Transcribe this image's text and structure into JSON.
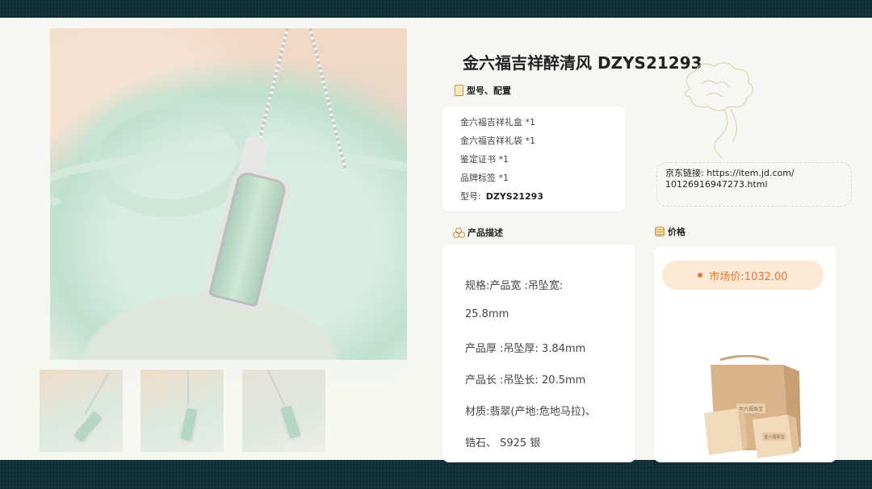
{
  "product": {
    "title": "金六福吉祥醉清风 DZYS21293"
  },
  "config_section": {
    "label": "型号、配置",
    "icon": "document-icon",
    "items": [
      "金六福吉祥礼盒 *1",
      "金六福吉祥礼袋 *1",
      "鉴定证书 *1",
      "品牌标签 *1"
    ],
    "model_label": "型号:",
    "model_value": "DZYS21293"
  },
  "link": {
    "label": "京东链接:",
    "url_part1": "https://item.jd.com/",
    "url_part2": "10126916947273.html"
  },
  "description_section": {
    "label": "产品描述",
    "icon": "cluster-icon",
    "lines": [
      "规格:产品宽 :吊坠宽:",
      "25.8mm",
      "产品厚 :吊坠厚: 3.84mm",
      "产品长 :吊坠长: 20.5mm",
      "材质:翡翠(产地:危地马拉)、",
      "锆石、 S925 银"
    ]
  },
  "price_section": {
    "label": "价格",
    "icon": "coins-icon",
    "market_price": "市场价:1032.00"
  },
  "gift_box": {
    "brand_text": "金六福珠宝"
  },
  "colors": {
    "accent_gold": "#c9963f",
    "price_orange": "#e07a3a",
    "price_bg": "#fde8d5",
    "slide_bg": "#f6f7f2"
  }
}
